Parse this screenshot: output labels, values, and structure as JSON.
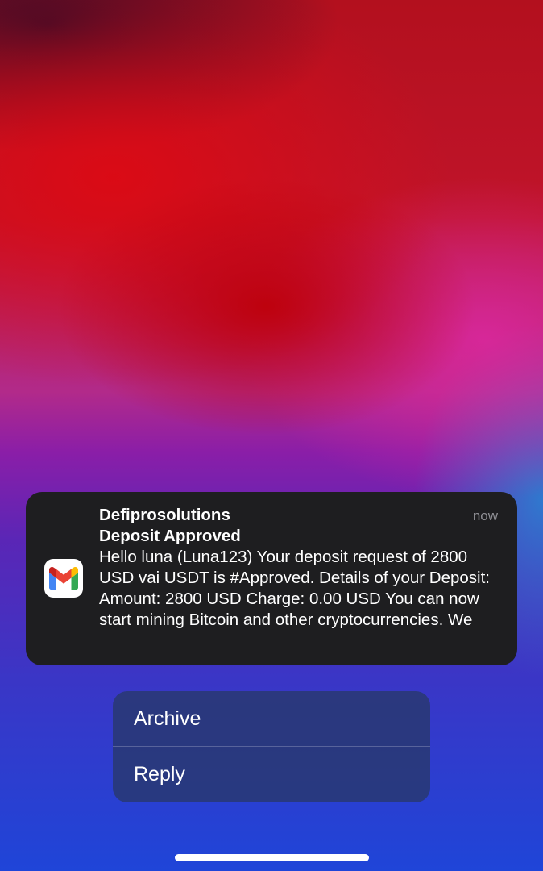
{
  "notification": {
    "app_icon": "gmail-icon",
    "sender": "Defiprosolutions",
    "subject": "Deposit Approved",
    "time": "now",
    "body": "Hello luna (Luna123) Your deposit request of 2800 USD vai USDT is #Approved. Details of your Deposit: Amount: 2800 USD Charge: 0.00 USD You can now start mining Bitcoin and other cryptocurrencies. We"
  },
  "actions": [
    {
      "label": "Archive"
    },
    {
      "label": "Reply"
    }
  ],
  "colors": {
    "notification_bg": "#1e1e20",
    "time_text": "#8e8e93",
    "gmail_red": "#EA4335",
    "gmail_blue": "#4285F4",
    "gmail_green": "#34A853",
    "gmail_yellow": "#FBBC04",
    "gmail_dark_red": "#C5221F"
  }
}
